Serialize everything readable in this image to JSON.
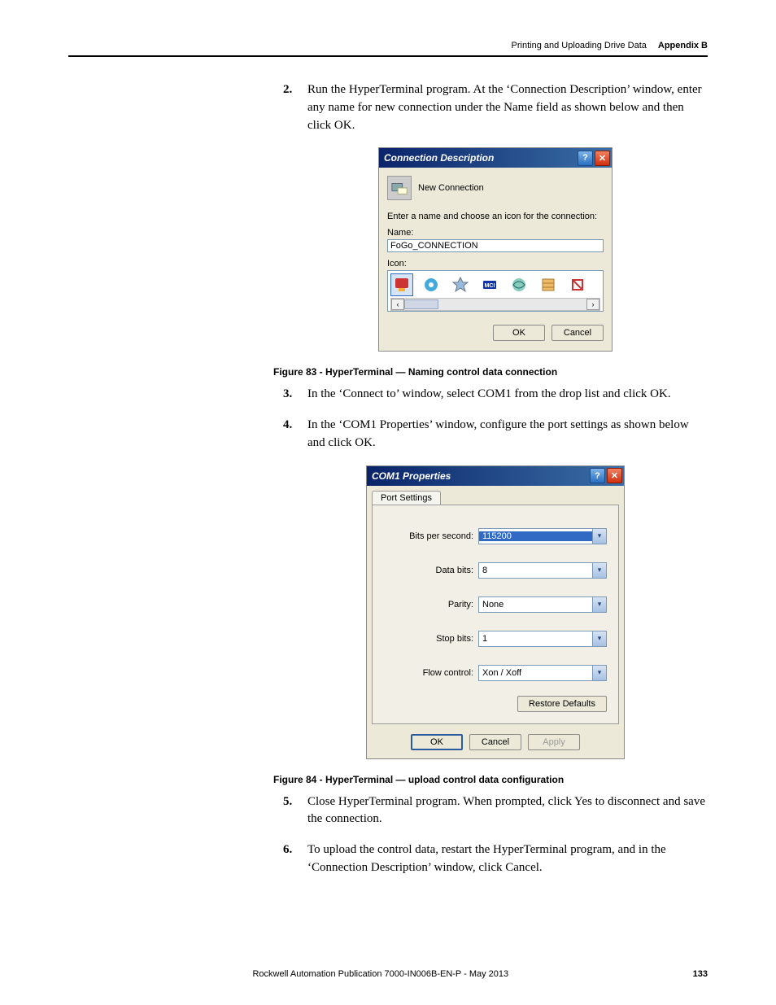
{
  "header": {
    "section": "Printing and Uploading Drive Data",
    "appendix": "Appendix B"
  },
  "steps": {
    "s2": {
      "num": "2.",
      "text": "Run the HyperTerminal program. At the ‘Connection Description’ window, enter any name for new connection under the Name field as shown below and then click OK."
    },
    "s3": {
      "num": "3.",
      "text": "In the ‘Connect to’ window, select COM1 from the drop list and click OK."
    },
    "s4": {
      "num": "4.",
      "text": "In the ‘COM1 Properties’ window, configure the port settings as shown below and click OK."
    },
    "s5": {
      "num": "5.",
      "text": "Close HyperTerminal program. When prompted, click Yes to disconnect and save the connection."
    },
    "s6": {
      "num": "6.",
      "text": "To upload the control data, restart the HyperTerminal program, and in the ‘Connection Description’ window, click Cancel."
    }
  },
  "captions": {
    "fig83": "Figure 83 - HyperTerminal — Naming control data connection",
    "fig84": "Figure 84 - HyperTerminal — upload control data configuration"
  },
  "dialog1": {
    "title": "Connection Description",
    "subtitle": "New Connection",
    "instr": "Enter a name and choose an icon for the connection:",
    "name_label": "Name:",
    "name_value": "FoGo_CONNECTION",
    "icon_label": "Icon:",
    "ok": "OK",
    "cancel": "Cancel"
  },
  "dialog2": {
    "title": "COM1 Properties",
    "tab": "Port Settings",
    "fields": {
      "bps": {
        "label": "Bits per second:",
        "value": "115200"
      },
      "data": {
        "label": "Data bits:",
        "value": "8"
      },
      "parity": {
        "label": "Parity:",
        "value": "None"
      },
      "stop": {
        "label": "Stop bits:",
        "value": "1"
      },
      "flow": {
        "label": "Flow control:",
        "value": "Xon / Xoff"
      }
    },
    "restore": "Restore Defaults",
    "ok": "OK",
    "cancel": "Cancel",
    "apply": "Apply"
  },
  "footer": {
    "pub": "Rockwell Automation Publication 7000-IN006B-EN-P - May 2013",
    "page": "133"
  },
  "glyphs": {
    "help": "?",
    "close": "✕",
    "left": "‹",
    "right": "›",
    "down": "▾"
  }
}
